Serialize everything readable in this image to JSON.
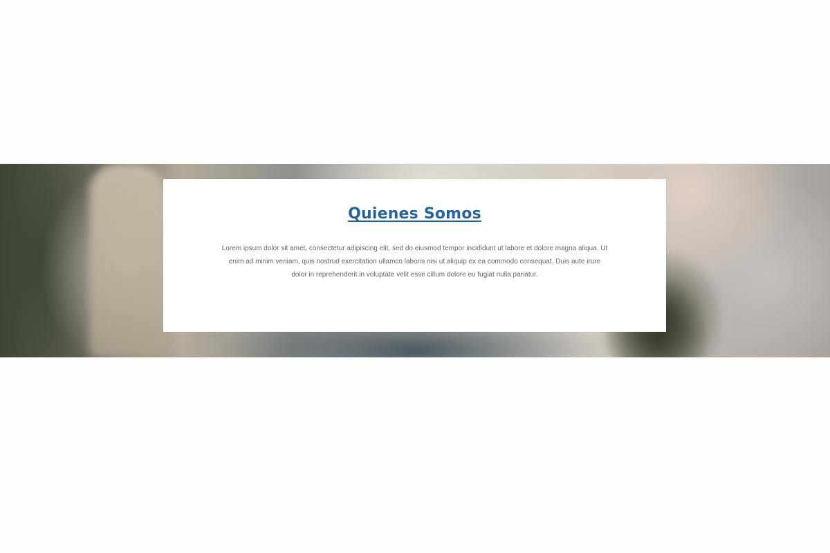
{
  "about": {
    "title": "Quienes Somos",
    "body": "Lorem ipsum dolor sit amet, consectetur adipiscing elit, sed do eiusmod tempor incididunt ut labore et dolore magna aliqua. Ut enim ad minim veniam, quis nostrud exercitation ullamco laboris nisi ut aliquip ex ea commodo consequat. Duis aute irure dolor in reprehenderit in voluptate velit esse cillum dolore eu fugiat nulla pariatur."
  },
  "colors": {
    "title_link": "#2a6496",
    "body_text": "#666666",
    "card_background": "#ffffff"
  }
}
